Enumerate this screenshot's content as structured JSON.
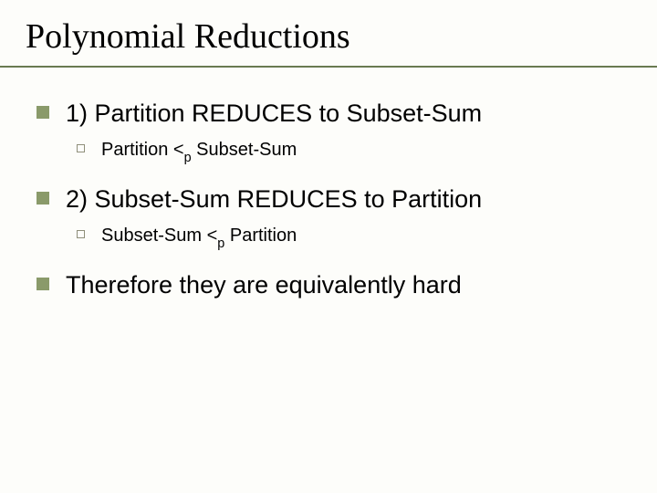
{
  "title": "Polynomial Reductions",
  "items": {
    "i1": {
      "text": "1) Partition REDUCES to Subset-Sum",
      "sub": {
        "pre": "Partition <",
        "sub": "p",
        "post": " Subset-Sum"
      }
    },
    "i2": {
      "text": "2) Subset-Sum REDUCES to Partition",
      "sub": {
        "pre": "Subset-Sum <",
        "sub": "p",
        "post": " Partition"
      }
    },
    "i3": {
      "text": "Therefore they are equivalently hard"
    }
  }
}
